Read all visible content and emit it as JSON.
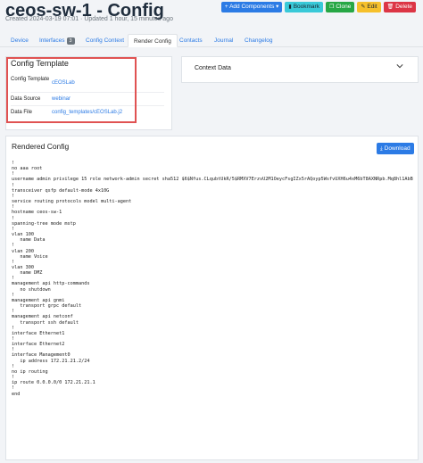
{
  "header": {
    "title": "ceos-sw-1 - Config",
    "subtitle": "Created 2024-03-19 07:01 · Updated 1 hour, 15 minutes ago"
  },
  "actions": {
    "add_components": "+ Add Components ▾",
    "bookmark": "Bookmark",
    "clone": "Clone",
    "edit": "Edit",
    "delete": "Delete"
  },
  "tabs": {
    "device": "Device",
    "interfaces": "Interfaces",
    "interfaces_count": "3",
    "config_context": "Config Context",
    "render_config": "Render Config",
    "contacts": "Contacts",
    "journal": "Journal",
    "changelog": "Changelog"
  },
  "config_template": {
    "title": "Config Template",
    "rows": [
      {
        "label": "Config Template",
        "value": "cEOSLab"
      },
      {
        "label": "Data Source",
        "value": "webinar"
      },
      {
        "label": "Data File",
        "value": "config_templates/cEOSLab.j2"
      }
    ]
  },
  "context_data": {
    "title": "Context Data"
  },
  "rendered": {
    "title": "Rendered Config",
    "download_label": "Download",
    "config_text": "!\nno aaa root\n!\nusername admin privilege 15 role network-admin secret sha512 $6$Nfus.CLqubtUkR/5$RMXV7ErzvU2M1OeycFsgIZx5rAQoyp5WsfvUXH6u4xM6bT8AXNRpb.Mq8hl1AbBj3PIK4CU\n!\ntransceiver qsfp default-mode 4x10G\n!\nservice routing protocols model multi-agent\n!\nhostname ceos-sw-1\n!\nspanning-tree mode mstp\n!\nvlan 100\n   name Data\n!\nvlan 200\n   name Voice\n!\nvlan 300\n   name DMZ\n!\nmanagement api http-commands\n   no shutdown\n!\nmanagement api gnmi\n   transport grpc default\n!\nmanagement api netconf\n   transport ssh default\n!\ninterface Ethernet1\n!\ninterface Ethernet2\n!\ninterface Management0\n   ip address 172.21.21.2/24\n!\nno ip routing\n!\nip route 0.0.0.0/0 172.21.21.1\n!\nend"
  },
  "colors": {
    "primary": "#2c7be5",
    "info": "#39c9d8",
    "success": "#27a745",
    "warning": "#f6c02b",
    "danger": "#dc3545",
    "highlight_box": "#e05252"
  }
}
